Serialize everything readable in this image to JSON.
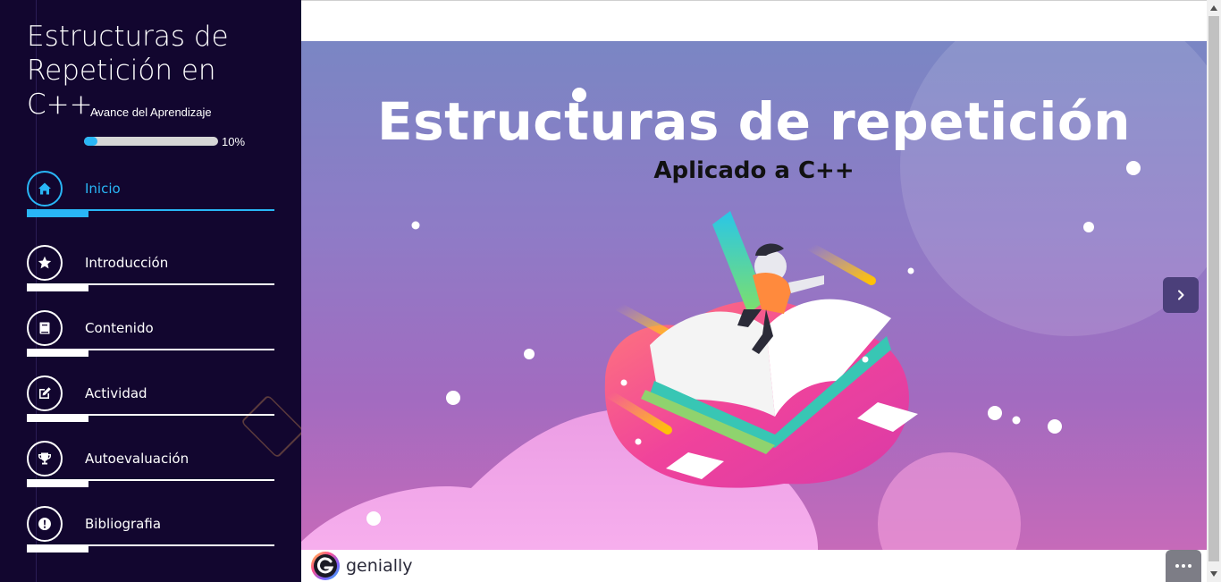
{
  "sidebar": {
    "course_title": "Estructuras de Repetición en C++.",
    "progress": {
      "label": "Avance del Aprendizaje",
      "value_text": "10%",
      "value_fraction": 0.1
    },
    "nav": [
      {
        "label": "Inicio",
        "icon": "home-icon",
        "active": true
      },
      {
        "label": "Introducción",
        "icon": "star-icon"
      },
      {
        "label": "Contenido",
        "icon": "book-icon"
      },
      {
        "label": "Actividad",
        "icon": "edit-icon"
      },
      {
        "label": "Autoevaluación",
        "icon": "trophy-icon"
      },
      {
        "label": "Bibliografia",
        "icon": "exclamation-icon"
      }
    ]
  },
  "stage": {
    "title": "Estructuras de repetición",
    "subtitle": "Aplicado a C++",
    "next_icon": "chevron-right-icon"
  },
  "footer": {
    "brand": "genially",
    "more_icon": "more-dots-icon"
  },
  "colors": {
    "sidebar_bg": "#12062f",
    "accent": "#29b6f6",
    "stage_top": "#7a86c4",
    "stage_bottom": "#c66ab9"
  }
}
